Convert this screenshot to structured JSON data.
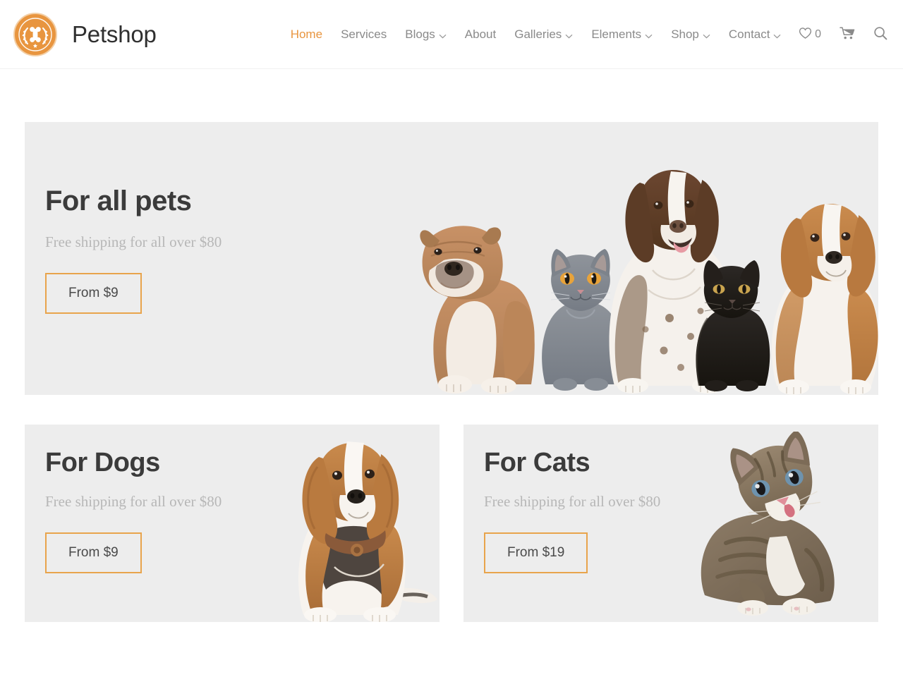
{
  "brand": {
    "name": "Petshop",
    "logo_icon": "bone-laurel-badge-icon",
    "accent_color": "#e8953f"
  },
  "nav": {
    "items": [
      {
        "label": "Home",
        "active": true,
        "has_dropdown": false
      },
      {
        "label": "Services",
        "active": false,
        "has_dropdown": false
      },
      {
        "label": "Blogs",
        "active": false,
        "has_dropdown": true
      },
      {
        "label": "About",
        "active": false,
        "has_dropdown": false
      },
      {
        "label": "Galleries",
        "active": false,
        "has_dropdown": true
      },
      {
        "label": "Elements",
        "active": false,
        "has_dropdown": true
      },
      {
        "label": "Shop",
        "active": false,
        "has_dropdown": true
      },
      {
        "label": "Contact",
        "active": false,
        "has_dropdown": true
      }
    ]
  },
  "actions": {
    "wishlist_icon": "heart-icon",
    "wishlist_count": "0",
    "cart_icon": "shopping-cart-icon",
    "search_icon": "search-icon"
  },
  "hero": {
    "title": "For all pets",
    "subtitle": "Free shipping for all over $80",
    "button": "From $9",
    "art": "group-of-pets-bulldog-gray-cat-spaniel-black-cat-beagle"
  },
  "promos": [
    {
      "title": "For Dogs",
      "subtitle": "Free shipping for all over $80",
      "button": "From $9",
      "art": "sitting-beagle-dog"
    },
    {
      "title": "For Cats",
      "subtitle": "Free shipping for all over $80",
      "button": "From $19",
      "art": "tabby-kitten"
    }
  ],
  "theme": {
    "accent": "#e8953f",
    "button_border": "#e8a44c",
    "card_bg": "#ededed",
    "title_color": "#3b3b3b",
    "sub_color": "#b7b7b7",
    "nav_color": "#8a8a8a",
    "page_bg": "#ffffff"
  }
}
